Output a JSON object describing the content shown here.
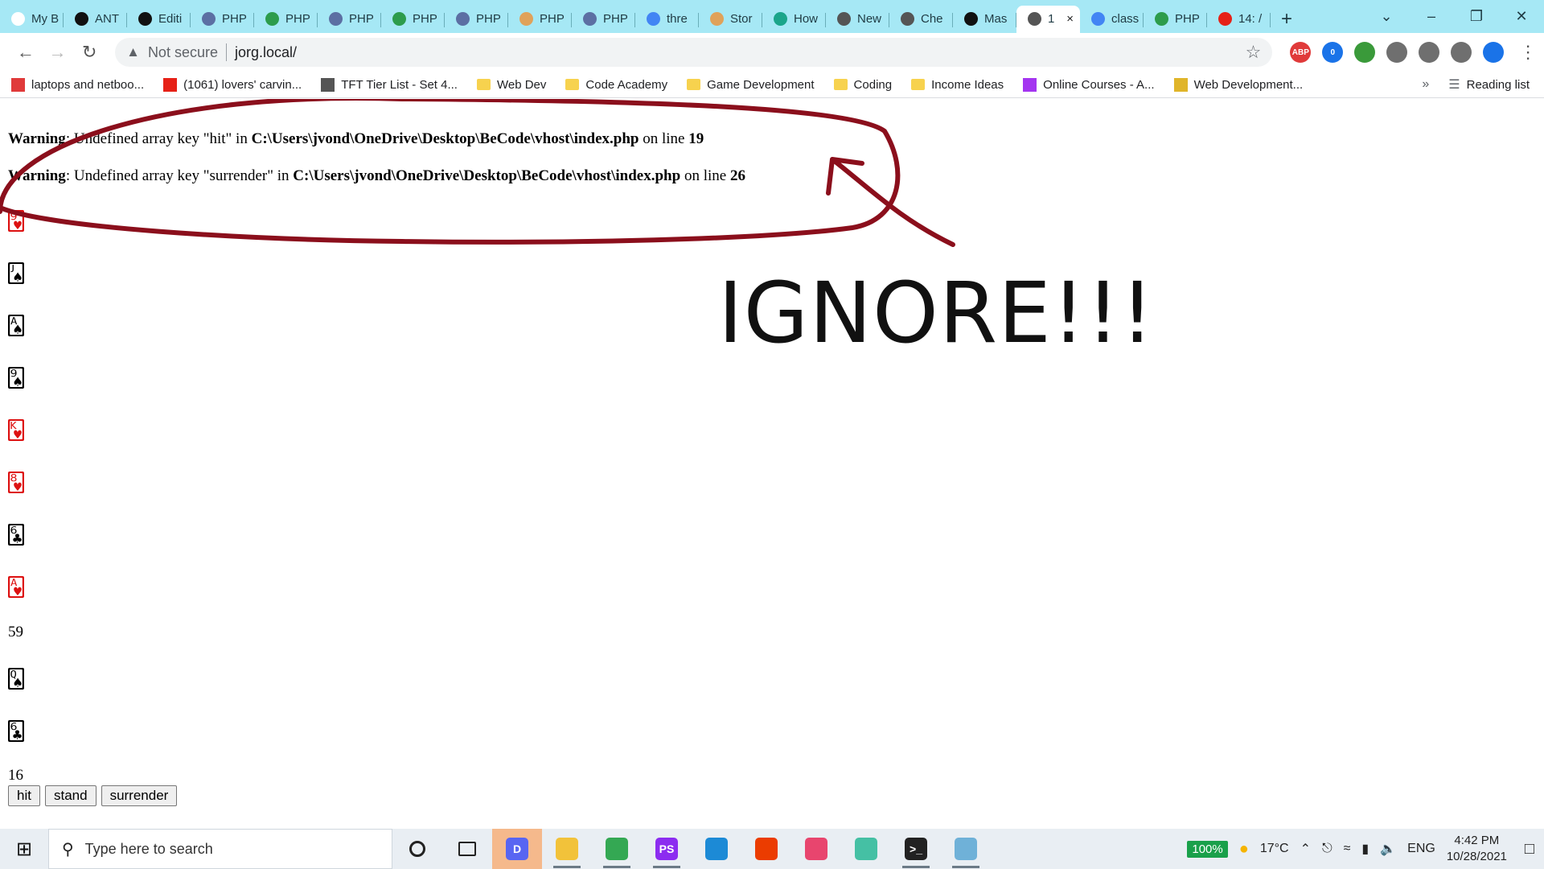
{
  "tabs": [
    {
      "label": "My B",
      "icon": "becode-icon",
      "color": "#ffffff"
    },
    {
      "label": "ANT",
      "icon": "github-icon",
      "color": "#111111"
    },
    {
      "label": "Editi",
      "icon": "github-icon",
      "color": "#111111"
    },
    {
      "label": "PHP",
      "icon": "php-icon",
      "color": "#5c6fa3"
    },
    {
      "label": "PHP",
      "icon": "w3schools-icon",
      "color": "#2d9c4c"
    },
    {
      "label": "PHP",
      "icon": "php-icon",
      "color": "#5c6fa3"
    },
    {
      "label": "PHP",
      "icon": "w3schools-icon",
      "color": "#2d9c4c"
    },
    {
      "label": "PHP",
      "icon": "php-icon",
      "color": "#5c6fa3"
    },
    {
      "label": "PHP",
      "icon": "stackoverflow-icon",
      "color": "#e0a25a"
    },
    {
      "label": "PHP",
      "icon": "php-icon",
      "color": "#5c6fa3"
    },
    {
      "label": "thre",
      "icon": "google-icon",
      "color": "#4285f4"
    },
    {
      "label": "Stor",
      "icon": "stackoverflow-icon",
      "color": "#e0a25a"
    },
    {
      "label": "How",
      "icon": "shield-icon",
      "color": "#1aa58a"
    },
    {
      "label": "New",
      "icon": "globe-icon",
      "color": "#555555"
    },
    {
      "label": "Che",
      "icon": "globe-icon",
      "color": "#555555"
    },
    {
      "label": "Mas",
      "icon": "github-icon",
      "color": "#111111"
    },
    {
      "label": "1",
      "icon": "globe-icon",
      "color": "#555555",
      "active": true
    },
    {
      "label": "class",
      "icon": "google-icon",
      "color": "#4285f4"
    },
    {
      "label": "PHP",
      "icon": "w3schools-icon",
      "color": "#2d9c4c"
    },
    {
      "label": "14: /",
      "icon": "youtube-icon",
      "color": "#e62117"
    }
  ],
  "toolbar": {
    "security_label": "Not secure",
    "url": "jorg.local/"
  },
  "extensions": [
    {
      "name": "adblock-icon",
      "label": "ABP",
      "color": "#e03a3a"
    },
    {
      "name": "badge-counter-icon",
      "label": "0",
      "color": "#1a73e8"
    },
    {
      "name": "globe-extension-icon",
      "label": "",
      "color": "#3a9a3a"
    },
    {
      "name": "gear-extension-icon",
      "label": "",
      "color": "#6f6f6f"
    },
    {
      "name": "puzzle-icon",
      "label": "",
      "color": "#6f6f6f"
    },
    {
      "name": "media-icon",
      "label": "",
      "color": "#6f6f6f"
    },
    {
      "name": "profile-avatar-icon",
      "label": "",
      "color": "#1a73e8"
    }
  ],
  "bookmarks": [
    {
      "label": "laptops and netboo...",
      "icon": "laptop-brand-icon",
      "color": "#e03a3a"
    },
    {
      "label": "(1061) lovers' carvin...",
      "icon": "youtube-icon",
      "color": "#e62117"
    },
    {
      "label": "TFT Tier List - Set 4...",
      "icon": "tft-icon",
      "color": "#555555"
    },
    {
      "label": "Web Dev",
      "icon": "folder-icon",
      "color": "#f7d24e"
    },
    {
      "label": "Code Academy",
      "icon": "folder-icon",
      "color": "#f7d24e"
    },
    {
      "label": "Game Development",
      "icon": "folder-icon",
      "color": "#f7d24e"
    },
    {
      "label": "Coding",
      "icon": "folder-icon",
      "color": "#f7d24e"
    },
    {
      "label": "Income Ideas",
      "icon": "folder-icon",
      "color": "#f7d24e"
    },
    {
      "label": "Online Courses - A...",
      "icon": "udemy-icon",
      "color": "#a435f0"
    },
    {
      "label": "Web Development...",
      "icon": "course-icon",
      "color": "#e0b52a"
    }
  ],
  "bookmarks_more": "»",
  "reading_list": "Reading list",
  "page": {
    "warnings": [
      {
        "prefix": "Warning",
        "text_before": ": Undefined array key \"hit\" in ",
        "path": "C:\\Users\\jvond\\OneDrive\\Desktop\\BeCode\\vhost\\index.php",
        "text_after": " on line ",
        "line": "19"
      },
      {
        "prefix": "Warning",
        "text_before": ": Undefined array key \"surrender\" in ",
        "path": "C:\\Users\\jvond\\OneDrive\\Desktop\\BeCode\\vhost\\index.php",
        "text_after": " on line ",
        "line": "26"
      }
    ],
    "player_cards": [
      {
        "glyph": "🂹",
        "suit_color": "#dd1111"
      },
      {
        "glyph": "🂫",
        "suit_color": "#000000"
      },
      {
        "glyph": "🂡",
        "suit_color": "#000000"
      },
      {
        "glyph": "🂩",
        "suit_color": "#000000"
      },
      {
        "glyph": "🂾",
        "suit_color": "#dd1111"
      },
      {
        "glyph": "🂸",
        "suit_color": "#dd1111"
      },
      {
        "glyph": "🃖",
        "suit_color": "#000000"
      },
      {
        "glyph": "🂱",
        "suit_color": "#dd1111"
      }
    ],
    "player_score": "59",
    "dealer_cards": [
      {
        "glyph": "🂭",
        "suit_color": "#000000"
      },
      {
        "glyph": "🃖",
        "suit_color": "#000000"
      }
    ],
    "dealer_score": "16",
    "buttons": {
      "hit": "hit",
      "stand": "stand",
      "surrender": "surrender"
    }
  },
  "annotation": {
    "text": "IGNORE!!!",
    "stroke_color": "#8b0f1c"
  },
  "taskbar": {
    "search_placeholder": "Type here to search",
    "apps": [
      {
        "name": "cortana-icon",
        "label": "",
        "color": "#222222"
      },
      {
        "name": "task-view-icon",
        "label": "",
        "color": "#222222"
      },
      {
        "name": "discord-icon",
        "label": "D",
        "color": "#5865f2",
        "highlight": true
      },
      {
        "name": "file-explorer-icon",
        "label": "",
        "color": "#f2c23a",
        "running": true
      },
      {
        "name": "chrome-icon",
        "label": "",
        "color": "#34a853",
        "running": true
      },
      {
        "name": "phpstorm-icon",
        "label": "PS",
        "color": "#8c2cf0",
        "running": true
      },
      {
        "name": "edge-icon",
        "label": "",
        "color": "#1c8ad6"
      },
      {
        "name": "office-icon",
        "label": "",
        "color": "#eb3c00"
      },
      {
        "name": "creative-cloud-icon",
        "label": "",
        "color": "#e8456e"
      },
      {
        "name": "git-kraken-icon",
        "label": "",
        "color": "#45c0a4"
      },
      {
        "name": "terminal-icon",
        "label": ">_",
        "color": "#222222",
        "running": true
      },
      {
        "name": "notes-icon",
        "label": "",
        "color": "#6fb1d8",
        "running": true
      }
    ],
    "zoom": "100%",
    "temperature": "17°C",
    "language": "ENG",
    "time": "4:42 PM",
    "date": "10/28/2021"
  }
}
